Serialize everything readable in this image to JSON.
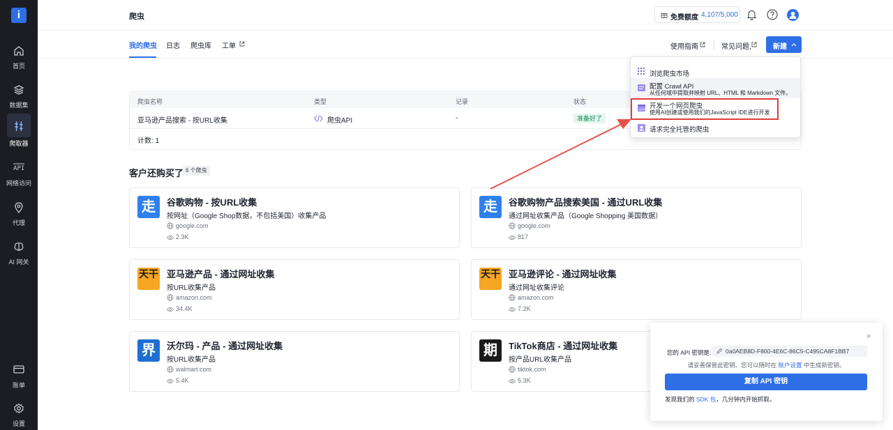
{
  "sidebar": {
    "logo_letter": "i",
    "items": [
      {
        "label": "首页",
        "icon": "home-icon"
      },
      {
        "label": "数据集",
        "icon": "layers-icon"
      },
      {
        "label": "爬取器",
        "icon": "scraper-icon"
      },
      {
        "label": "网络访问",
        "icon": "api-icon"
      },
      {
        "label": "代理",
        "icon": "location-pin-icon"
      },
      {
        "label": "AI 网关",
        "icon": "brain-icon"
      }
    ],
    "bottom_items": [
      {
        "label": "账单",
        "icon": "card-icon"
      },
      {
        "label": "设置",
        "icon": "gear-icon"
      }
    ]
  },
  "header": {
    "title": "爬虫",
    "quota_label": "免费额度",
    "quota_value": "4,107/5,000"
  },
  "tabs": [
    {
      "label": "我的爬虫",
      "active": true
    },
    {
      "label": "日志"
    },
    {
      "label": "爬虫库"
    },
    {
      "label": "工单",
      "external": true
    }
  ],
  "top_links": {
    "guide": "使用指南",
    "faq": "常见问题,",
    "new_button": "新建"
  },
  "crawler_table": {
    "columns": [
      "爬虫名称",
      "类型",
      "记录",
      "状态"
    ],
    "rows": [
      {
        "name": "亚马逊产品搜索 - 按URL收集",
        "type": "爬虫API",
        "records": "-",
        "status": "准备好了"
      }
    ],
    "count": "计数: 1"
  },
  "customers": {
    "title": "客户还购买了",
    "badge": "6 个爬虫",
    "cards": [
      {
        "icon_text": "走",
        "icon_color": "#2f80ed",
        "title": "谷歌购物 - 按URL收集",
        "desc": "按网址（Google Shop数据，不包括美国）收集产品",
        "domain": "google.com",
        "views": "2.3K"
      },
      {
        "icon_text": "走",
        "icon_color": "#2f80ed",
        "title": "谷歌购物产品搜索美国 - 通过URL收集",
        "desc": "通过网址收集产品（Google Shopping 美国数据）",
        "domain": "google.com",
        "views": "817"
      },
      {
        "icon_text": "天干",
        "icon_color": "#f5a623",
        "title": "亚马逊产品 - 通过网址收集",
        "desc": "按URL收集产品",
        "domain": "amazon.com",
        "views": "34.4K"
      },
      {
        "icon_text": "天干",
        "icon_color": "#f5a623",
        "title": "亚马逊评论 - 通过网址收集",
        "desc": "通过网址收集评论",
        "domain": "amazon.com",
        "views": "7.2K"
      },
      {
        "icon_text": "界",
        "icon_color": "#1f6fd1",
        "title": "沃尔玛 - 产品 - 通过网址收集",
        "desc": "按URL收集产品",
        "domain": "walmart.com",
        "views": "5.4K"
      },
      {
        "icon_text": "期",
        "icon_color": "#1a1a1a",
        "title": "TikTok商店 - 通过网址收集",
        "desc": "按产品URL收集产品",
        "domain": "tiktok.com",
        "views": "5.3K"
      }
    ]
  },
  "dropdown": {
    "items": [
      {
        "title": "浏览爬虫市场"
      },
      {
        "title": "配置 Crawl API",
        "subtitle": "从任何域中提取并映射 URL、HTML 和 Markdown 文件。"
      },
      {
        "title": "开发一个网页爬虫",
        "subtitle": "使用AI创建或使用我们的JavaScript IDE进行开发"
      },
      {
        "title": "请求完全托管的爬虫"
      }
    ]
  },
  "api_panel": {
    "close": "×",
    "key_label": "您的 API 密钥是:",
    "key_value": "0a0AEB8D-F800-4E6C-86C5-C495CA8F1BB7",
    "note_prefix": "请妥善保管此密钥。您可以随时在 ",
    "note_link": "账户设置",
    "note_suffix": " 中生成新密钥。",
    "copy_button": "复制 API 密钥",
    "sdk_prefix": "发现我们的 ",
    "sdk_link": "SDK 包",
    "sdk_suffix": "，几分钟内开始抓取。"
  },
  "colors": {
    "accent": "#2f6fe6",
    "sidebar_bg": "#1b1d23",
    "highlight": "#e23b3b",
    "status_ready": "#1b8a5a"
  }
}
